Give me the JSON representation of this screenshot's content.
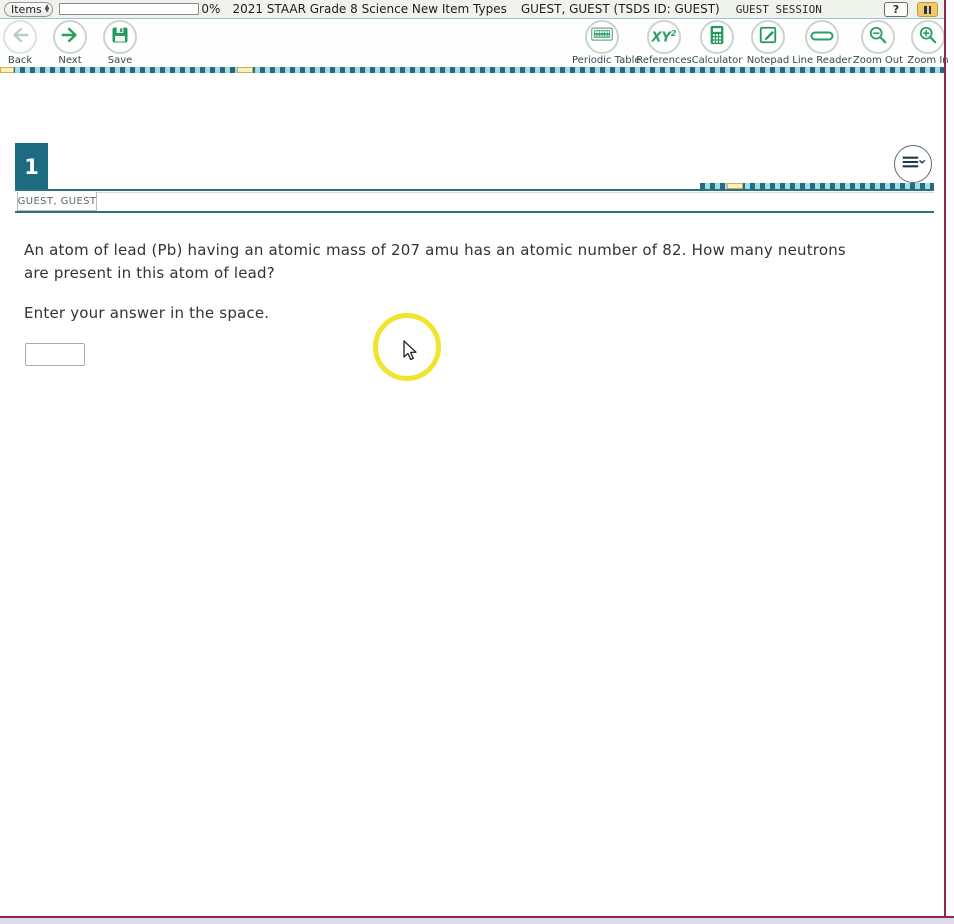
{
  "top_bar": {
    "items_label": "Items",
    "progress_percent": "0%",
    "test_title": "2021 STAAR Grade 8 Science New Item Types",
    "user": "GUEST, GUEST (TSDS ID: GUEST)",
    "session": "GUEST SESSION",
    "help_label": "?"
  },
  "toolbar": {
    "left": [
      {
        "label": "Back",
        "icon": "arrow-left",
        "disabled": true
      },
      {
        "label": "Next",
        "icon": "arrow-right"
      },
      {
        "label": "Save",
        "icon": "floppy-disk"
      }
    ],
    "right": [
      {
        "label": "Periodic Table",
        "icon": "periodic-table"
      },
      {
        "label": "References",
        "icon": "xy-squared",
        "icon_text": "XY",
        "icon_sup": "2"
      },
      {
        "label": "Calculator",
        "icon": "calculator"
      },
      {
        "label": "Notepad",
        "icon": "notepad"
      },
      {
        "label": "Line Reader",
        "icon": "line-reader"
      },
      {
        "label": "Zoom Out",
        "icon": "zoom-out"
      },
      {
        "label": "Zoom In",
        "icon": "zoom-in"
      }
    ]
  },
  "question": {
    "number": "1",
    "student_tab": "GUEST, GUEST",
    "prompt": "An atom of lead (Pb) having an atomic mass of 207 amu has an atomic number of 82. How many neutrons are present in this atom of lead?",
    "instruction": "Enter your answer in the space.",
    "answer_value": ""
  },
  "colors": {
    "accent_teal": "#1d6b80",
    "toolbar_green": "#2aa065",
    "dash_dark": "#2b6879",
    "dash_light": "#9adfe3",
    "highlight_yellow": "#f0e42c",
    "window_maroon": "#93274e"
  }
}
